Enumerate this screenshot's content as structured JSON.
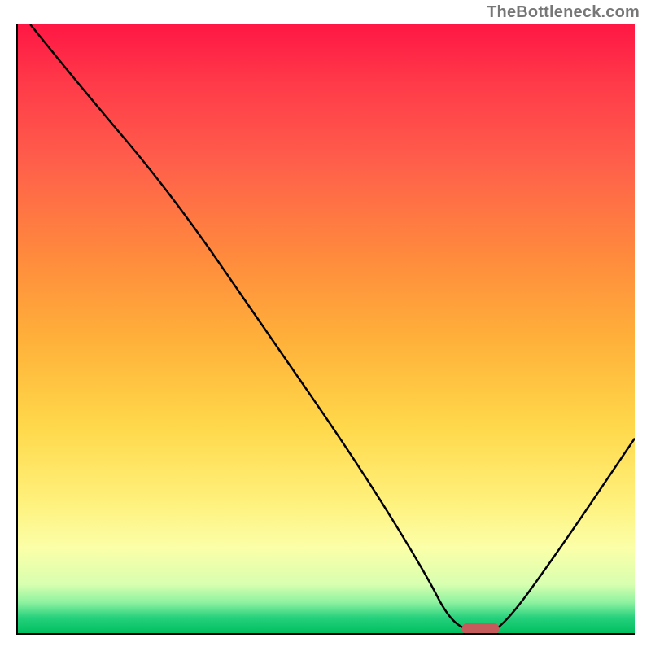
{
  "watermark": "TheBottleneck.com",
  "chart_data": {
    "type": "line",
    "title": "",
    "xlabel": "",
    "ylabel": "",
    "xlim": [
      0,
      100
    ],
    "ylim": [
      0,
      100
    ],
    "grid": false,
    "series": [
      {
        "name": "curve",
        "x": [
          2,
          10,
          25,
          40,
          55,
          66,
          70,
          74,
          78,
          88,
          100
        ],
        "values": [
          100,
          90,
          72,
          50,
          28,
          10,
          2,
          0,
          0,
          14,
          32
        ],
        "color": "#000000"
      }
    ],
    "marker": {
      "x_start": 72,
      "x_end": 78,
      "y": 0,
      "color": "#c65b5b"
    },
    "background_gradient": [
      {
        "stop": 0.0,
        "color": "#ff1744"
      },
      {
        "stop": 0.1,
        "color": "#ff3b49"
      },
      {
        "stop": 0.22,
        "color": "#ff5d4b"
      },
      {
        "stop": 0.38,
        "color": "#ff8a3d"
      },
      {
        "stop": 0.52,
        "color": "#ffb13a"
      },
      {
        "stop": 0.66,
        "color": "#ffd84a"
      },
      {
        "stop": 0.78,
        "color": "#fff07a"
      },
      {
        "stop": 0.86,
        "color": "#fbffa8"
      },
      {
        "stop": 0.92,
        "color": "#d8ffb0"
      },
      {
        "stop": 0.95,
        "color": "#8cf2a0"
      },
      {
        "stop": 0.975,
        "color": "#25d07c"
      },
      {
        "stop": 1.0,
        "color": "#00c060"
      }
    ]
  }
}
